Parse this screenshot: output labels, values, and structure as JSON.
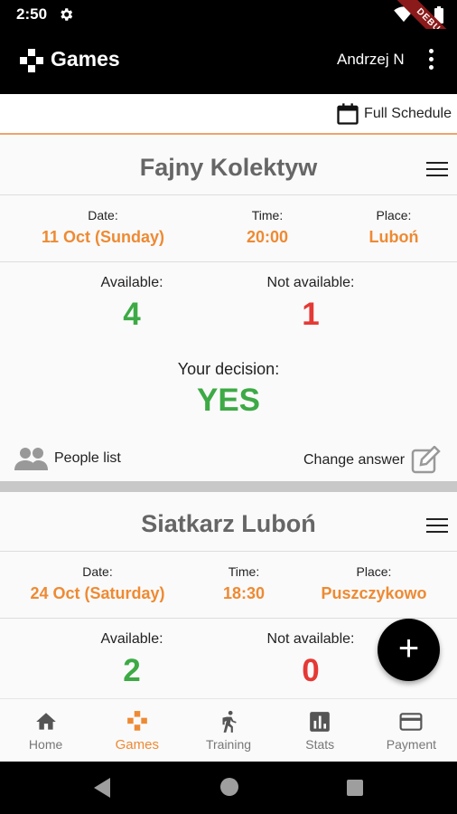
{
  "status": {
    "time": "2:50",
    "ribbon": "DEBUG"
  },
  "app_bar": {
    "title": "Games",
    "user": "Andrzej N",
    "logo_icon": "gamepad-icon",
    "menu_icon": "more-vert-icon"
  },
  "schedule": {
    "label": "Full Schedule",
    "icon": "calendar-icon"
  },
  "games": [
    {
      "team": "Fajny Kolektyw",
      "date_label": "Date:",
      "date": "11 Oct (Sunday)",
      "time_label": "Time:",
      "time": "20:00",
      "place_label": "Place:",
      "place": "Luboń",
      "available_label": "Available:",
      "available": "4",
      "not_available_label": "Not available:",
      "not_available": "1",
      "decision_label": "Your decision:",
      "decision": "YES",
      "people_list": "People list",
      "change_answer": "Change answer"
    },
    {
      "team": "Siatkarz Luboń",
      "date_label": "Date:",
      "date": "24 Oct (Saturday)",
      "time_label": "Time:",
      "time": "18:30",
      "place_label": "Place:",
      "place": "Puszczykowo",
      "available_label": "Available:",
      "available": "2",
      "not_available_label": "Not available:",
      "not_available": "0"
    }
  ],
  "fab": {
    "label": "+"
  },
  "nav": [
    {
      "label": "Home",
      "icon": "home-icon"
    },
    {
      "label": "Games",
      "icon": "gamepad-icon",
      "active": true
    },
    {
      "label": "Training",
      "icon": "running-icon"
    },
    {
      "label": "Stats",
      "icon": "bar-chart-icon"
    },
    {
      "label": "Payment",
      "icon": "credit-card-icon"
    }
  ],
  "colors": {
    "accent": "#ee8a33",
    "positive": "#3daa45",
    "negative": "#e53935",
    "bar": "#000000"
  }
}
